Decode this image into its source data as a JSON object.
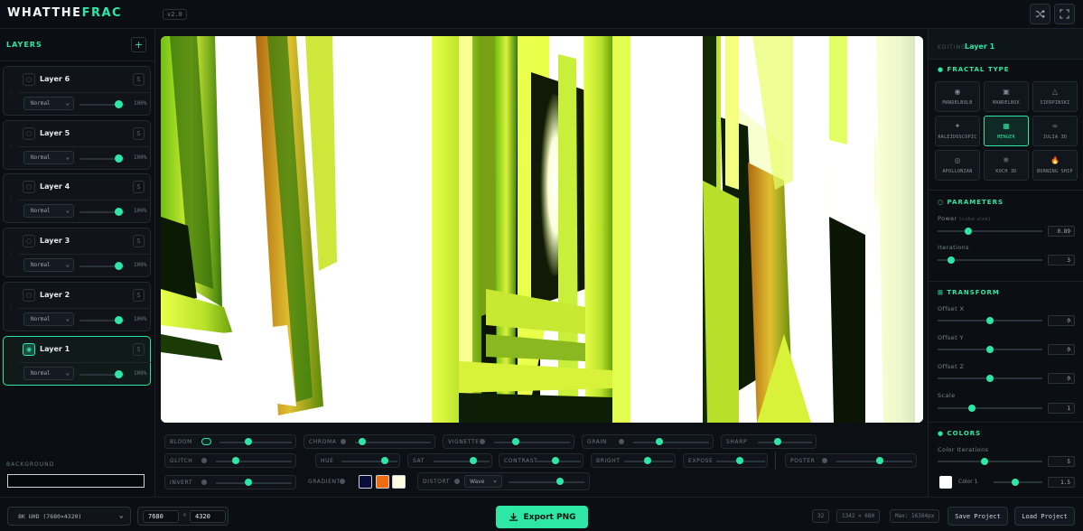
{
  "app": {
    "logo_main": "WHATTHE",
    "logo_accent": "FRAC",
    "version": "v2.0"
  },
  "header": {
    "shuffle_icon": "shuffle-icon",
    "fullscreen_icon": "fullscreen-icon"
  },
  "layers_panel": {
    "title": "LAYERS",
    "add_label": "+",
    "layers": [
      {
        "name": "Layer 6",
        "blend": "Normal",
        "opacity": "100%",
        "opacity_value": 100,
        "solo": "S",
        "visible": false
      },
      {
        "name": "Layer 5",
        "blend": "Normal",
        "opacity": "100%",
        "opacity_value": 100,
        "solo": "S",
        "visible": false
      },
      {
        "name": "Layer 4",
        "blend": "Normal",
        "opacity": "100%",
        "opacity_value": 100,
        "solo": "S",
        "visible": false
      },
      {
        "name": "Layer 3",
        "blend": "Normal",
        "opacity": "100%",
        "opacity_value": 100,
        "solo": "S",
        "visible": false
      },
      {
        "name": "Layer 2",
        "blend": "Normal",
        "opacity": "100%",
        "opacity_value": 100,
        "solo": "S",
        "visible": false
      },
      {
        "name": "Layer 1",
        "blend": "Normal",
        "opacity": "100%",
        "opacity_value": 100,
        "solo": "S",
        "visible": true
      }
    ],
    "background_label": "BACKGROUND",
    "background_color": "#060708"
  },
  "effects": {
    "bloom": "BLOOM",
    "chroma": "CHROMA",
    "vignette": "VIGNETTE",
    "grain": "GRAIN",
    "sharp": "SHARP",
    "glitch": "GLITCH",
    "hue": "HUE",
    "sat": "SAT",
    "contrast": "CONTRAST",
    "bright": "BRIGHT",
    "expose": "EXPOSE",
    "poster": "POSTER",
    "invert": "INVERT",
    "gradient": "GRADIENT",
    "distort": "DISTORT",
    "distort_mode": "Wave",
    "gradient_colors": [
      "#0a0c3a",
      "#f06a10",
      "#fffbe0"
    ]
  },
  "inspector": {
    "editing_label": "EDITING",
    "editing_name": "Layer 1",
    "fractal_type_title": "FRACTAL TYPE",
    "fractal_types": [
      {
        "name": "MANDELBULB",
        "icon": "◉",
        "selected": false
      },
      {
        "name": "MANDELBOX",
        "icon": "▣",
        "selected": false
      },
      {
        "name": "SIERPINSKI",
        "icon": "△",
        "selected": false
      },
      {
        "name": "KALEIDOSCOPIC",
        "icon": "✦",
        "selected": false
      },
      {
        "name": "MENGER",
        "icon": "▦",
        "selected": true
      },
      {
        "name": "JULIA 3D",
        "icon": "∞",
        "selected": false
      },
      {
        "name": "APOLLONIAN",
        "icon": "◎",
        "selected": false
      },
      {
        "name": "KOCH 3D",
        "icon": "❄",
        "selected": false
      },
      {
        "name": "BURNING SHIP",
        "icon": "🔥",
        "selected": false
      }
    ],
    "parameters_title": "PARAMETERS",
    "power_label": "Power",
    "power_sub": "(cube size)",
    "power_value": "0.89",
    "iterations_label": "Iterations",
    "iterations_value": "3",
    "transform_title": "TRANSFORM",
    "offset_x_label": "Offset X",
    "offset_x_value": "0",
    "offset_y_label": "Offset Y",
    "offset_y_value": "0",
    "offset_z_label": "Offset Z",
    "offset_z_value": "0",
    "scale_label": "Scale",
    "scale_value": "1",
    "colors_title": "COLORS",
    "color_iterations_label": "Color Iterations",
    "color_iterations_value": "5",
    "color1_label": "Color 1",
    "color1_value": "1.5"
  },
  "bottom": {
    "resolution_preset": "8K UHD (7680×4320)",
    "width": "7680",
    "height": "4320",
    "times": "×",
    "export_label": "Export PNG",
    "chip_32": "32",
    "canvas_size": "1342 × 680",
    "max_label": "Max: 16384px",
    "save_label": "Save Project",
    "load_label": "Load Project"
  },
  "colors": {
    "accent": "#2ee6a6",
    "background": "#0c0f14"
  }
}
